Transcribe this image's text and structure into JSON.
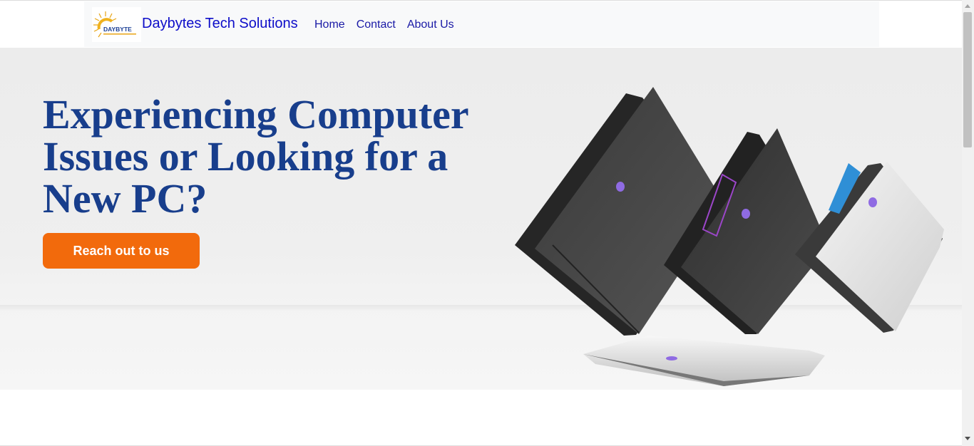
{
  "navbar": {
    "brand": "Daybytes Tech Solutions",
    "logo_text": "DAYBYTE",
    "links": [
      {
        "label": "Home"
      },
      {
        "label": "Contact"
      },
      {
        "label": "About Us"
      }
    ]
  },
  "hero": {
    "title": "Experiencing Computer Issues or Looking for a New PC?",
    "cta_label": "Reach out to us"
  },
  "colors": {
    "brand_link": "#0d0dc9",
    "title": "#183e8c",
    "cta": "#f26a0c"
  }
}
